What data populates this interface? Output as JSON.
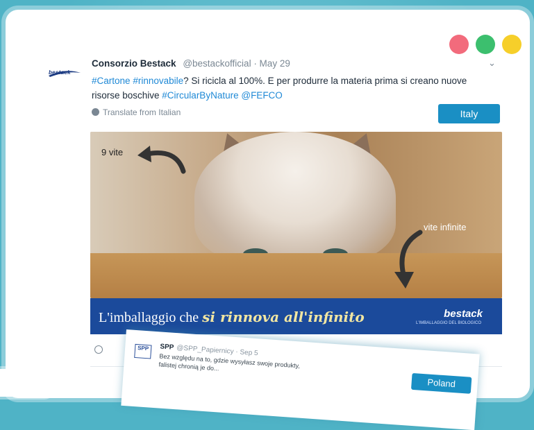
{
  "window": {
    "dots": [
      "#f26b7c",
      "#3cbf6e",
      "#f6cf2a"
    ]
  },
  "tweet": {
    "logo_text": "bestack",
    "author_name": "Consorzio Bestack",
    "author_meta": "@bestackofficial · May 29",
    "text_parts": {
      "h1": "#Cartone",
      "h2": "#rinnovabile",
      "t1": "? Si ricicla al 100%. E per produrre la materia prima si creano nuove risorse boschive ",
      "h3": "#CircularByNature",
      "h4": "@FEFCO"
    },
    "translate_label": "Translate from Italian",
    "country_badge": "Italy",
    "image": {
      "label_left": "9 vite",
      "label_right": "vite infinite",
      "banner_plain": "L'imballaggio che ",
      "banner_italic": "si rinnova all'infinito",
      "banner_logo": "bestack",
      "banner_logo_sub": "L'IMBALLAGGIO DEL BIOLOGICO"
    }
  },
  "tweet2": {
    "logo_text": "SPP",
    "author_name": "SPP",
    "author_meta": "@SPP_Papiernicy · Sep 5",
    "line1": "Bez względu na to, gdzie wysyłasz swoje produkty,",
    "line2": "falistej chronią je do...",
    "country_badge": "Poland"
  }
}
